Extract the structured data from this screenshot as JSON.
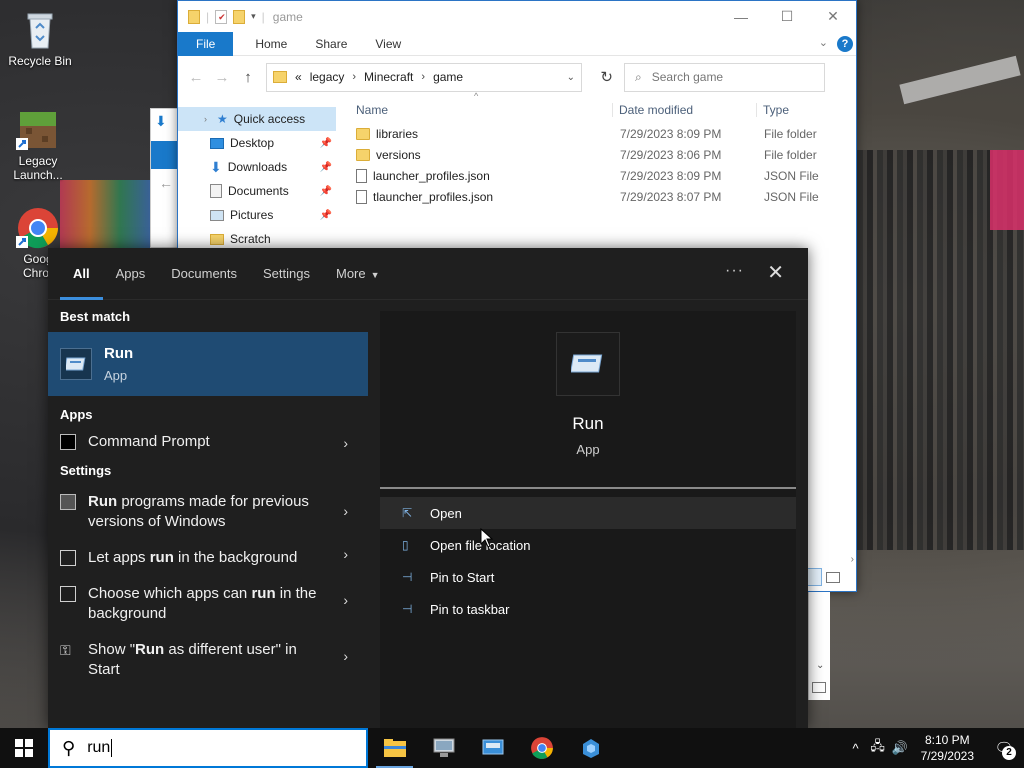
{
  "desktop": {
    "icons": [
      {
        "label": "Recycle Bin",
        "icon": "recycle-bin-icon"
      },
      {
        "label": "Legacy Launch...",
        "icon": "minecraft-grass-block-icon"
      },
      {
        "label": "Goog Chror",
        "icon": "chrome-icon"
      }
    ]
  },
  "explorer": {
    "title": "game",
    "ribbon": {
      "file": "File",
      "home": "Home",
      "share": "Share",
      "view": "View",
      "help": "?"
    },
    "breadcrumb": {
      "overflow": "«",
      "items": [
        "legacy",
        "Minecraft",
        "game"
      ]
    },
    "search_placeholder": "Search game",
    "nav": [
      {
        "label": "Quick access",
        "icon": "star-icon",
        "pinned": false
      },
      {
        "label": "Desktop",
        "icon": "desktop-icon",
        "pinned": true
      },
      {
        "label": "Downloads",
        "icon": "download-icon",
        "pinned": true
      },
      {
        "label": "Documents",
        "icon": "documents-icon",
        "pinned": true
      },
      {
        "label": "Pictures",
        "icon": "pictures-icon",
        "pinned": true
      },
      {
        "label": "Scratch",
        "icon": "folder-icon",
        "pinned": false
      }
    ],
    "columns": {
      "name": "Name",
      "date": "Date modified",
      "type": "Type"
    },
    "files": [
      {
        "name": "libraries",
        "date": "7/29/2023 8:09 PM",
        "type": "File folder",
        "kind": "folder"
      },
      {
        "name": "versions",
        "date": "7/29/2023 8:06 PM",
        "type": "File folder",
        "kind": "folder"
      },
      {
        "name": "launcher_profiles.json",
        "date": "7/29/2023 8:09 PM",
        "type": "JSON File",
        "kind": "file"
      },
      {
        "name": "tlauncher_profiles.json",
        "date": "7/29/2023 8:07 PM",
        "type": "JSON File",
        "kind": "file"
      }
    ]
  },
  "search_panel": {
    "tabs": [
      "All",
      "Apps",
      "Documents",
      "Settings",
      "More"
    ],
    "sections": {
      "best_match": "Best match",
      "apps": "Apps",
      "settings": "Settings"
    },
    "best_match": {
      "name": "Run",
      "type": "App"
    },
    "apps": [
      {
        "label": "Command Prompt"
      }
    ],
    "settings": [
      {
        "pre": "",
        "bold": "Run",
        "post": " programs made for previous versions of Windows"
      },
      {
        "pre": "Let apps ",
        "bold": "run",
        "post": " in the background"
      },
      {
        "pre": "Choose which apps can ",
        "bold": "run",
        "post": " in the background"
      },
      {
        "pre": "Show \"",
        "bold": "Run",
        "post": " as different user\" in Start"
      }
    ],
    "preview": {
      "name": "Run",
      "type": "App",
      "actions": [
        "Open",
        "Open file location",
        "Pin to Start",
        "Pin to taskbar"
      ]
    }
  },
  "searchbox": {
    "value": "run"
  },
  "taskbar": {
    "apps": [
      "file-explorer-icon",
      "computer-icon",
      "control-panel-icon",
      "chrome-icon",
      "app-icon"
    ],
    "clock_time": "8:10 PM",
    "clock_date": "7/29/2023",
    "notification_count": "2"
  },
  "colors": {
    "accent": "#0078d7",
    "selected": "#1f4b73",
    "panel": "#1f1f1f"
  }
}
